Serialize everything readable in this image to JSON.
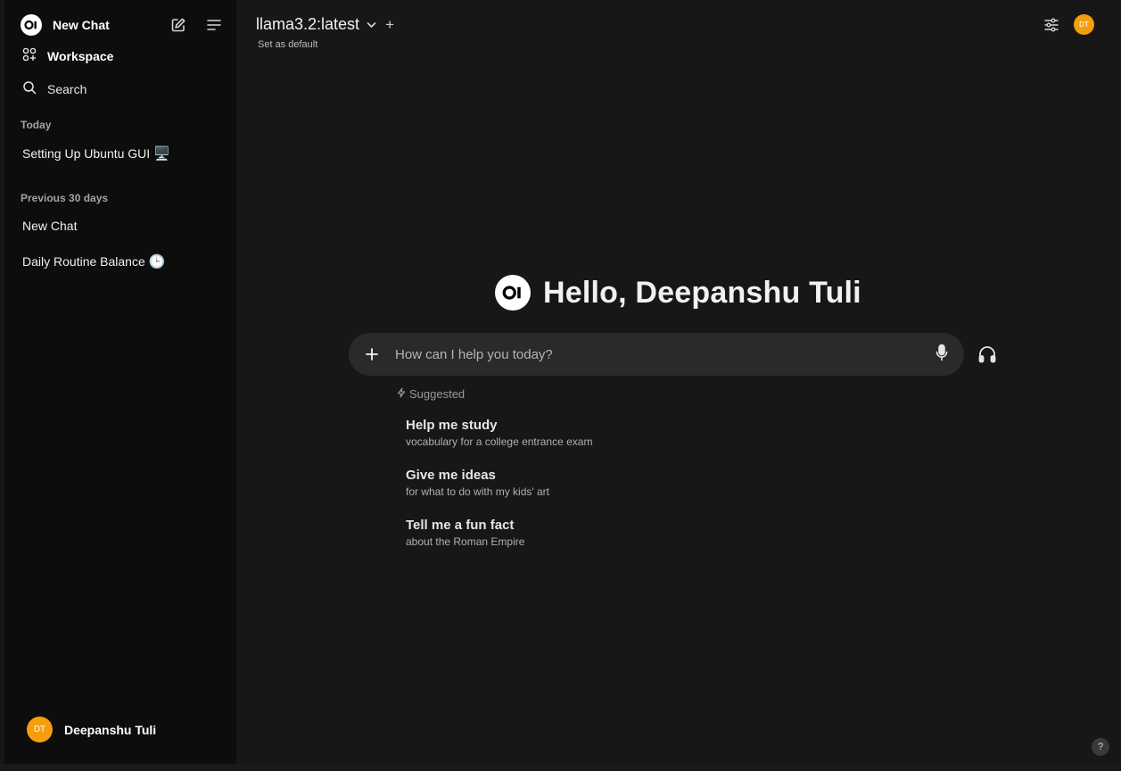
{
  "sidebar": {
    "new_chat_label": "New Chat",
    "workspace_label": "Workspace",
    "search_label": "Search",
    "sections": [
      {
        "label": "Today",
        "chats": [
          {
            "title": "Setting Up Ubuntu GUI",
            "emoji": "🖥️"
          }
        ]
      },
      {
        "label": "Previous 30 days",
        "chats": [
          {
            "title": "New Chat",
            "emoji": ""
          },
          {
            "title": "Daily Routine Balance",
            "emoji": "🕒"
          }
        ]
      }
    ],
    "user": {
      "initials": "DT",
      "name": "Deepanshu Tuli"
    }
  },
  "header": {
    "model_name": "llama3.2:latest",
    "add_model_symbol": "+",
    "set_default_label": "Set as default",
    "avatar_initials": "DT"
  },
  "main": {
    "greeting": "Hello, Deepanshu Tuli",
    "input_placeholder": "How can I help you today?",
    "suggested_label": "Suggested",
    "suggestions": [
      {
        "title": "Help me study",
        "subtitle": "vocabulary for a college entrance exam"
      },
      {
        "title": "Give me ideas",
        "subtitle": "for what to do with my kids' art"
      },
      {
        "title": "Tell me a fun fact",
        "subtitle": "about the Roman Empire"
      }
    ],
    "help_symbol": "?"
  },
  "colors": {
    "sidebar_bg": "#0d0d0d",
    "main_bg": "#171717",
    "input_bg": "#2a2a2a",
    "avatar": "#f59e0b"
  }
}
